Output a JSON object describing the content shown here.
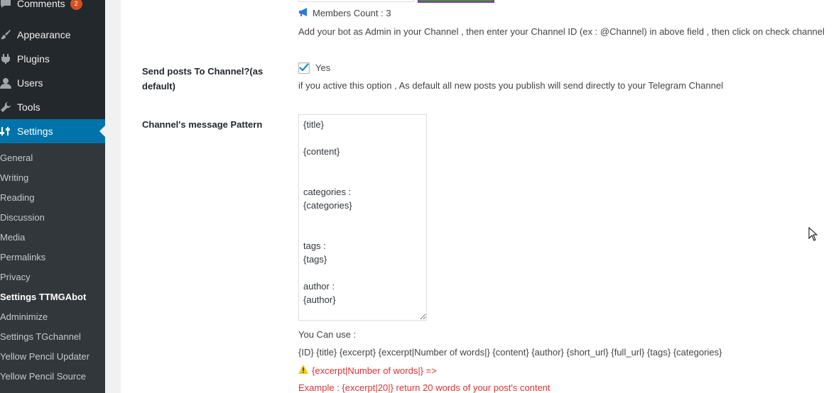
{
  "sidebar": {
    "items": [
      {
        "label": "Comments",
        "icon": "comments-icon",
        "badge": "2"
      },
      {
        "label": "Appearance",
        "icon": "appearance-icon"
      },
      {
        "label": "Plugins",
        "icon": "plugins-icon"
      },
      {
        "label": "Users",
        "icon": "users-icon"
      },
      {
        "label": "Tools",
        "icon": "tools-icon"
      },
      {
        "label": "Settings",
        "icon": "settings-icon",
        "active": true
      }
    ],
    "submenu": [
      "General",
      "Writing",
      "Reading",
      "Discussion",
      "Media",
      "Permalinks",
      "Privacy",
      "Settings TTMGAbot",
      "Adminimize",
      "Settings TGchannel",
      "Yellow Pencil Updater",
      "Yellow Pencil Source"
    ],
    "current_submenu": "Settings TTMGAbot"
  },
  "channel": {
    "members_count": "Members Count : 3",
    "help_text": "Add your bot as Admin in your Channel , then enter your Channel ID (ex : @Channel) in above field , then click on check channel"
  },
  "send_posts": {
    "label": "Send posts To Channel?(as default)",
    "checkbox_label": "Yes",
    "checked": true,
    "description": "if you active this option , As default all new posts you publish will send directly to your Telegram Channel"
  },
  "pattern": {
    "label": "Channel's message Pattern",
    "value": "{title}\n\n{content}\n\n\ncategories :\n{categories}\n\n\ntags :\n{tags}\n\nauthor :\n{author}",
    "you_can_use": "You Can use :",
    "tokens": "{ID} {title} {excerpt} {excerpt|Number of words|} {content} {author} {short_url} {full_url} {tags} {categories}",
    "warning": "{excerpt|Number of words|} =>",
    "example": "Example : {excerpt|20|} return 20 words of your post's content"
  },
  "colors": {
    "sidebar_bg": "#23282d",
    "submenu_bg": "#32373c",
    "active_blue": "#0073aa",
    "warning_red": "#dc3232",
    "checkmark_blue": "#1e8cbe"
  }
}
